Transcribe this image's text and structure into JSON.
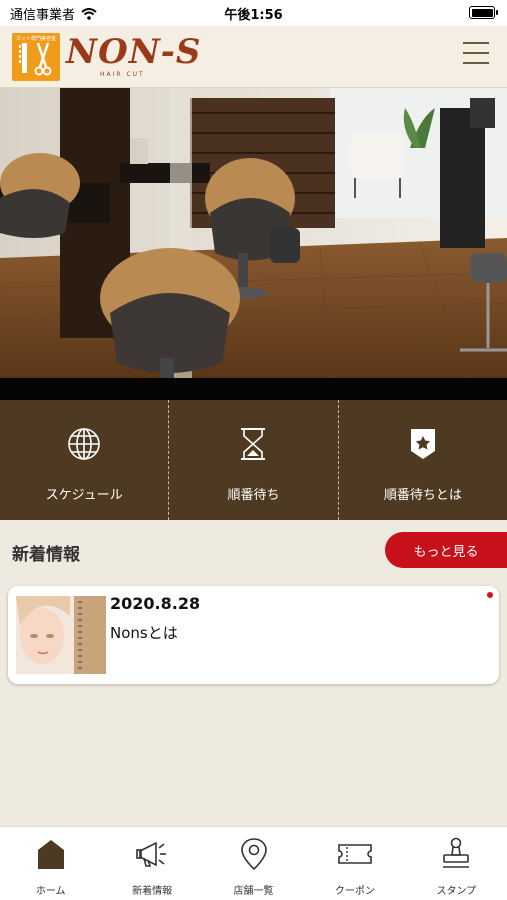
{
  "status_bar": {
    "carrier": "通信事業者",
    "time": "午後1:56"
  },
  "header": {
    "logo_tag": "カット専門美容室",
    "logo_text": "NON-S",
    "logo_sub": "HAIR CUT"
  },
  "quick_nav": [
    {
      "label": "スケジュール",
      "icon": "globe-icon"
    },
    {
      "label": "順番待ち",
      "icon": "hourglass-icon"
    },
    {
      "label": "順番待ちとは",
      "icon": "shield-star-icon"
    }
  ],
  "news": {
    "title": "新着情報",
    "more_label": "もっと見る",
    "items": [
      {
        "date": "2020.8.28",
        "text": "Nonsとは"
      }
    ]
  },
  "tab_bar": [
    {
      "label": "ホーム",
      "icon": "home-icon"
    },
    {
      "label": "新着情報",
      "icon": "megaphone-icon"
    },
    {
      "label": "店舗一覧",
      "icon": "map-pin-icon"
    },
    {
      "label": "クーポン",
      "icon": "ticket-icon"
    },
    {
      "label": "スタンプ",
      "icon": "stamp-icon"
    }
  ],
  "colors": {
    "brown": "#4e3a22",
    "accent_red": "#c8101b",
    "logo_orange": "#f29a1a",
    "background": "#efeadf"
  }
}
